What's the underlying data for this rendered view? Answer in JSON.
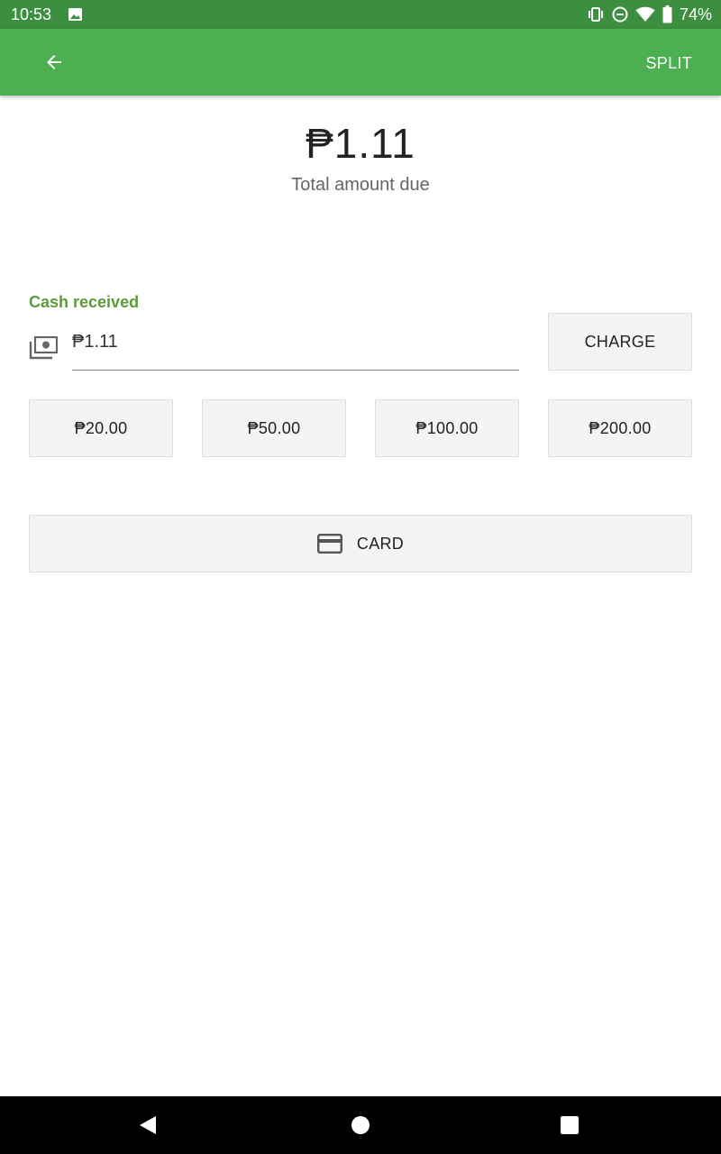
{
  "status_bar": {
    "time": "10:53",
    "battery_percent": "74%",
    "icons": [
      "image-icon",
      "vibrate-icon",
      "do-not-disturb-icon",
      "wifi-icon",
      "battery-icon"
    ]
  },
  "app_bar": {
    "back_icon": "arrow-left-icon",
    "split_label": "SPLIT",
    "background_color": "#4caf50"
  },
  "summary": {
    "total_amount": "₱1.11",
    "total_label": "Total amount due"
  },
  "cash": {
    "label": "Cash received",
    "label_color": "#5b9b39",
    "icon": "money-icon",
    "value": "₱1.11",
    "charge_label": "CHARGE"
  },
  "quick_amounts": [
    "₱20.00",
    "₱50.00",
    "₱100.00",
    "₱200.00"
  ],
  "card": {
    "icon": "credit-card-icon",
    "label": "CARD"
  },
  "nav_bar": {
    "icons": [
      "nav-back-icon",
      "nav-home-icon",
      "nav-recents-icon"
    ]
  }
}
